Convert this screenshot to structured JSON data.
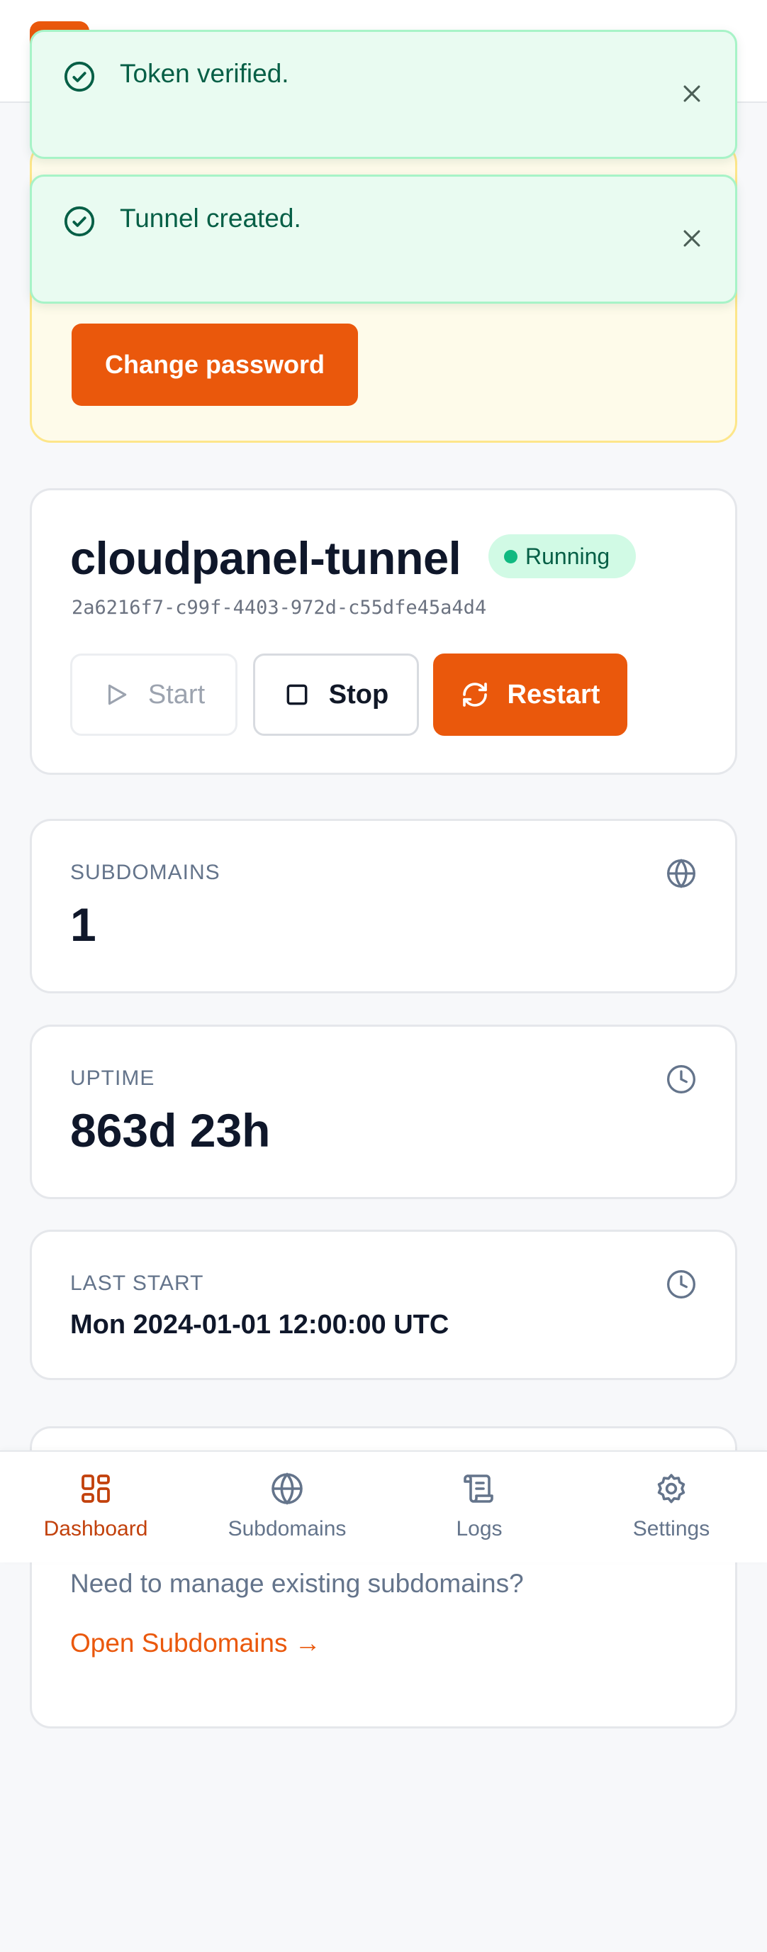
{
  "toasts": [
    {
      "text": "Token verified."
    },
    {
      "text": "Tunnel created."
    }
  ],
  "security": {
    "change_password_label": "Change password"
  },
  "tunnel": {
    "name": "cloudpanel-tunnel",
    "status": "Running",
    "id": "2a6216f7-c99f-4403-972d-c55dfe45a4d4",
    "actions": {
      "start": "Start",
      "stop": "Stop",
      "restart": "Restart"
    }
  },
  "stats": {
    "subdomains": {
      "label": "SUBDOMAINS",
      "value": "1"
    },
    "uptime": {
      "label": "UPTIME",
      "value": "863d 23h"
    },
    "last_start": {
      "label": "LAST START",
      "value": "Mon 2024-01-01 12:00:00 UTC"
    }
  },
  "manage": {
    "text": "Need to manage existing subdomains?",
    "link": "Open Subdomains →"
  },
  "nav": {
    "items": [
      {
        "label": "Dashboard",
        "icon": "dashboard-icon",
        "active": true
      },
      {
        "label": "Subdomains",
        "icon": "globe-icon",
        "active": false
      },
      {
        "label": "Logs",
        "icon": "scroll-icon",
        "active": false
      },
      {
        "label": "Settings",
        "icon": "gear-icon",
        "active": false
      }
    ]
  },
  "colors": {
    "accent": "#ea580c",
    "success": "#10b981",
    "toast_bg": "#e9fbf1",
    "warning_bg": "#fefbea"
  }
}
